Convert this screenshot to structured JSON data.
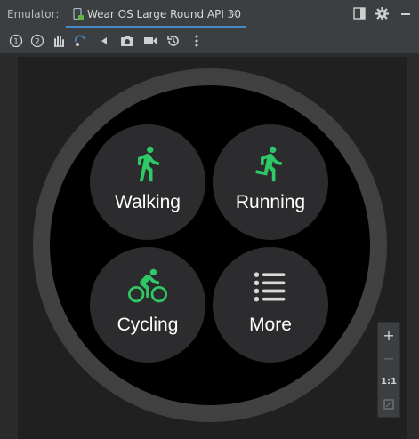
{
  "panel": {
    "label": "Emulator:"
  },
  "tab": {
    "title": "Wear OS Large Round API 30",
    "close": "×"
  },
  "toolbar": {
    "icons": [
      "power-1-icon",
      "power-2-icon",
      "gesture-icon",
      "rotate-icon",
      "back-icon",
      "camera-icon",
      "record-icon",
      "snapshot-icon",
      "more-icon"
    ]
  },
  "watch": {
    "tiles": [
      {
        "label": "Walking",
        "icon": "walking-icon"
      },
      {
        "label": "Running",
        "icon": "running-icon"
      },
      {
        "label": "Cycling",
        "icon": "cycling-icon"
      },
      {
        "label": "More",
        "icon": "list-icon"
      }
    ]
  },
  "zoom": {
    "in": "+",
    "out": "−",
    "ratio": "1:1"
  },
  "colors": {
    "accent": "#4a88c7",
    "activity_green": "#2ec866",
    "tile_bg": "#2c2c2e"
  }
}
